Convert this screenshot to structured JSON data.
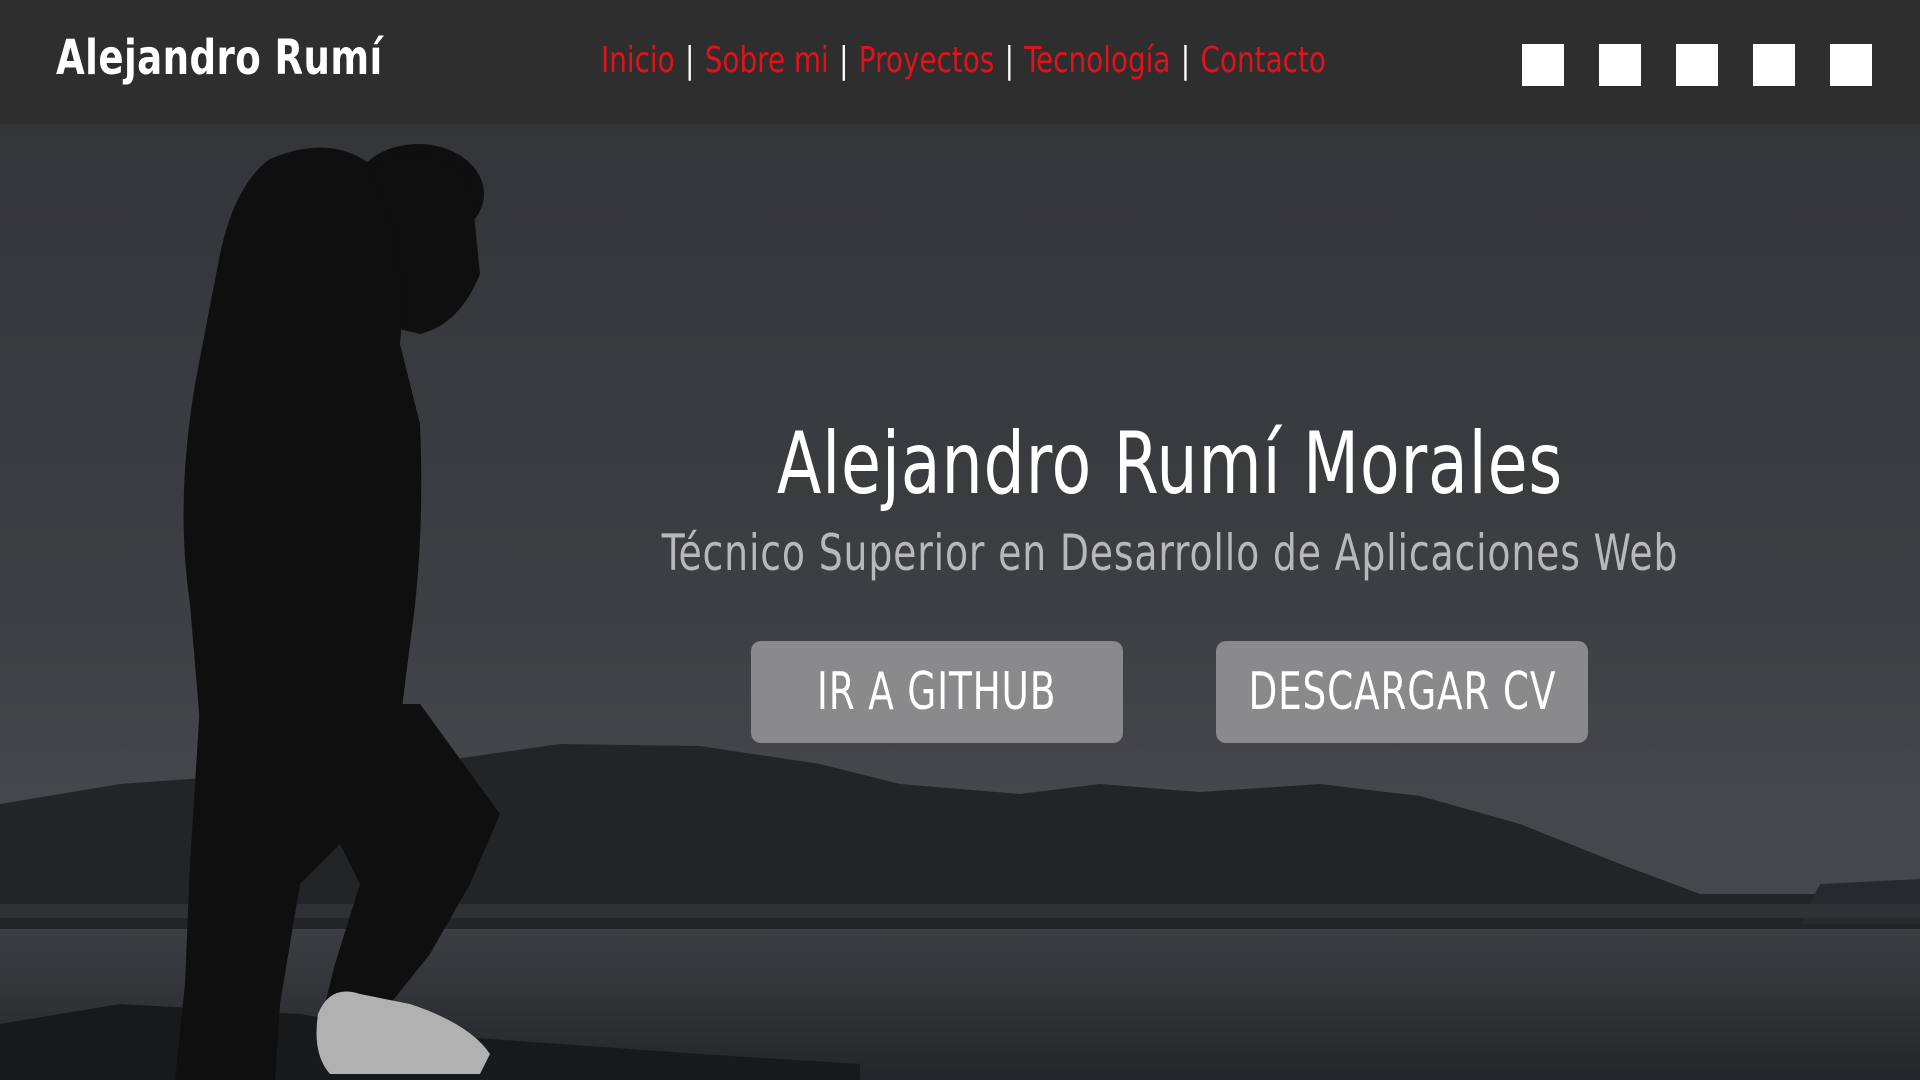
{
  "header": {
    "brand": "Alejandro Rumí",
    "nav": [
      {
        "label": "Inicio"
      },
      {
        "label": "Sobre mi"
      },
      {
        "label": "Proyectos"
      },
      {
        "label": "Tecnología"
      },
      {
        "label": "Contacto"
      }
    ],
    "separator": "|",
    "social_icons": [
      "social-icon-1",
      "social-icon-2",
      "social-icon-3",
      "social-icon-4",
      "social-icon-5"
    ]
  },
  "hero": {
    "title": "Alejandro Rumí Morales",
    "subtitle": "Técnico Superior en Desarrollo de Aplicaciones Web",
    "buttons": {
      "github": "IR A GITHUB",
      "cv": "DESCARGAR CV"
    }
  },
  "colors": {
    "header_bg": "#2e2e2f",
    "nav_link": "#e1121a",
    "button_bg": "#8a8a8c",
    "title": "#ffffff",
    "subtitle": "#b8b8b8"
  }
}
